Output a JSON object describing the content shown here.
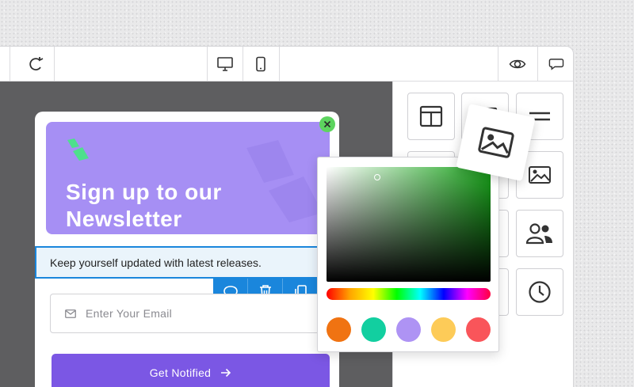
{
  "popup": {
    "headline": "Sign up to our Newsletter",
    "subline": "Keep yourself updated with latest releases.",
    "email_placeholder": "Enter Your Email",
    "cta_label": "Get Notified"
  },
  "colors": {
    "hero": "#a68ff4",
    "cta": "#7b57e4",
    "selection": "#1a86dc",
    "close": "#5dd45f",
    "picker_hue": "#1aa31c",
    "swatches": [
      "#f07312",
      "#12cfa0",
      "#ae93f4",
      "#fdcb58",
      "#f9555a"
    ]
  },
  "icons": {
    "toolbar_left": [
      "undo-icon",
      "redo-icon"
    ],
    "toolbar_center": [
      "desktop-icon",
      "mobile-icon"
    ],
    "toolbar_right": [
      "eye-icon",
      "comment-icon"
    ],
    "panel_blocks": [
      "columns-icon",
      "container-icon",
      "divider-icon",
      "image-icon",
      "users-icon",
      "clock-icon"
    ],
    "selection_tools": [
      "comment-icon",
      "trash-icon",
      "copy-icon"
    ]
  }
}
